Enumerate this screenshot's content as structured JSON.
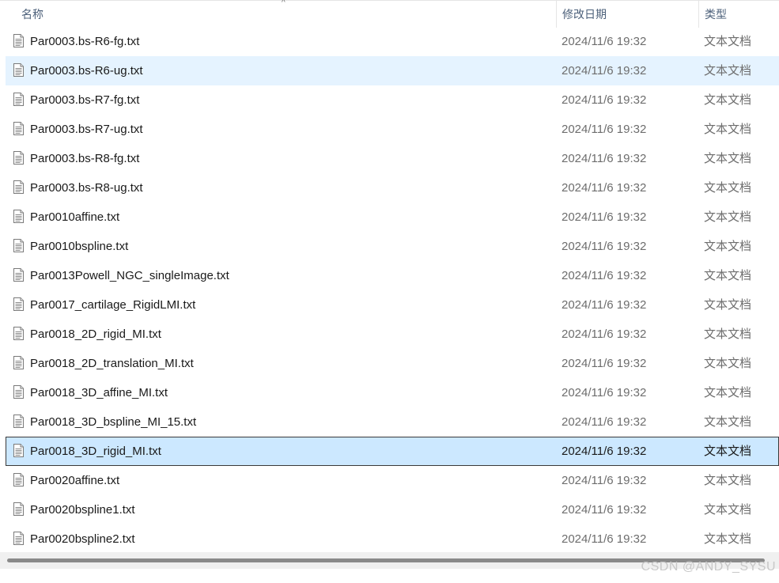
{
  "columns": {
    "name": "名称",
    "modified": "修改日期",
    "type": "类型"
  },
  "sort_indicator": "^",
  "icons": {
    "file": "text-file-icon",
    "sort": "sort-ascending-icon"
  },
  "files": [
    {
      "name": "Par0003.bs-R6-fg.txt",
      "modified": "2024/11/6 19:32",
      "type": "文本文档",
      "state": "normal"
    },
    {
      "name": "Par0003.bs-R6-ug.txt",
      "modified": "2024/11/6 19:32",
      "type": "文本文档",
      "state": "hover"
    },
    {
      "name": "Par0003.bs-R7-fg.txt",
      "modified": "2024/11/6 19:32",
      "type": "文本文档",
      "state": "normal"
    },
    {
      "name": "Par0003.bs-R7-ug.txt",
      "modified": "2024/11/6 19:32",
      "type": "文本文档",
      "state": "normal"
    },
    {
      "name": "Par0003.bs-R8-fg.txt",
      "modified": "2024/11/6 19:32",
      "type": "文本文档",
      "state": "normal"
    },
    {
      "name": "Par0003.bs-R8-ug.txt",
      "modified": "2024/11/6 19:32",
      "type": "文本文档",
      "state": "normal"
    },
    {
      "name": "Par0010affine.txt",
      "modified": "2024/11/6 19:32",
      "type": "文本文档",
      "state": "normal"
    },
    {
      "name": "Par0010bspline.txt",
      "modified": "2024/11/6 19:32",
      "type": "文本文档",
      "state": "normal"
    },
    {
      "name": "Par0013Powell_NGC_singleImage.txt",
      "modified": "2024/11/6 19:32",
      "type": "文本文档",
      "state": "normal"
    },
    {
      "name": "Par0017_cartilage_RigidLMI.txt",
      "modified": "2024/11/6 19:32",
      "type": "文本文档",
      "state": "normal"
    },
    {
      "name": "Par0018_2D_rigid_MI.txt",
      "modified": "2024/11/6 19:32",
      "type": "文本文档",
      "state": "normal"
    },
    {
      "name": "Par0018_2D_translation_MI.txt",
      "modified": "2024/11/6 19:32",
      "type": "文本文档",
      "state": "normal"
    },
    {
      "name": "Par0018_3D_affine_MI.txt",
      "modified": "2024/11/6 19:32",
      "type": "文本文档",
      "state": "normal"
    },
    {
      "name": "Par0018_3D_bspline_MI_15.txt",
      "modified": "2024/11/6 19:32",
      "type": "文本文档",
      "state": "normal"
    },
    {
      "name": "Par0018_3D_rigid_MI.txt",
      "modified": "2024/11/6 19:32",
      "type": "文本文档",
      "state": "selected"
    },
    {
      "name": "Par0020affine.txt",
      "modified": "2024/11/6 19:32",
      "type": "文本文档",
      "state": "normal"
    },
    {
      "name": "Par0020bspline1.txt",
      "modified": "2024/11/6 19:32",
      "type": "文本文档",
      "state": "normal"
    },
    {
      "name": "Par0020bspline2.txt",
      "modified": "2024/11/6 19:32",
      "type": "文本文档",
      "state": "normal"
    }
  ],
  "watermark": "CSDN @ANDY_SYSU",
  "colors": {
    "hover": "#e5f3ff",
    "selected": "#cce8ff",
    "header_text": "#4c607a"
  }
}
